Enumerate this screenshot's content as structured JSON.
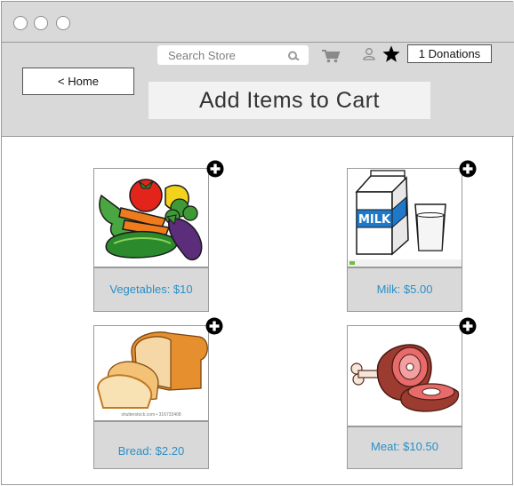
{
  "window": {
    "controls": [
      "close",
      "minimize",
      "maximize"
    ]
  },
  "header": {
    "search": {
      "placeholder": "Search Store",
      "icon": "search-icon"
    },
    "icons": {
      "cart": "cart-icon",
      "user": "user-icon",
      "favorites": "star-icon"
    },
    "donations_label": "1 Donations",
    "home_label": "< Home",
    "title": "Add Items to Cart"
  },
  "products": [
    {
      "label": "Vegetables: $10",
      "image": "vegetables-image"
    },
    {
      "label": "Milk: $5.00",
      "image": "milk-image"
    },
    {
      "label": "Bread: $2.20",
      "image": "bread-image",
      "caption": "shutterstock.com • 316733408"
    },
    {
      "label": "Meat: $10.50",
      "image": "meat-image"
    }
  ],
  "colors": {
    "chrome": "#d9d9d9",
    "label_text": "#2a8fc7",
    "border": "#9a9a9a"
  }
}
